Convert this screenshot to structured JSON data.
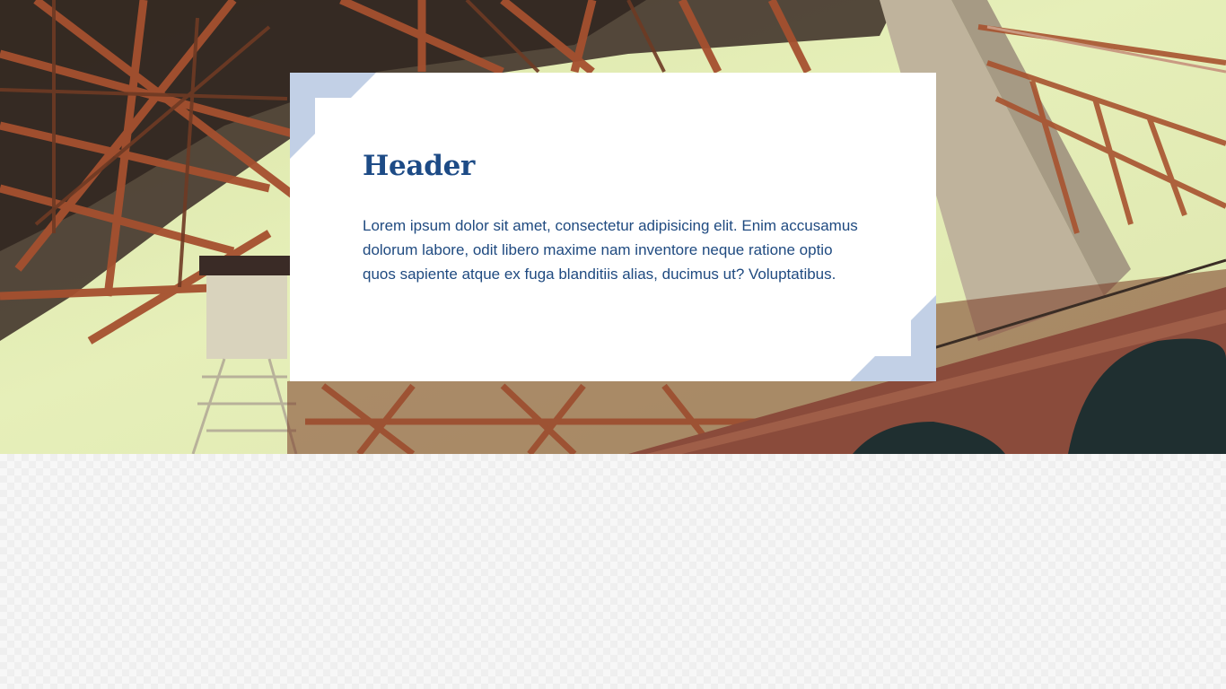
{
  "card": {
    "title": "Header",
    "body": "Lorem ipsum dolor sit amet, consectetur adipisicing elit. Enim accusamus dolorum labore, odit libero maxime nam inventore neque ratione optio quos sapiente atque ex fuga blanditiis alias, ducimus ut? Voluptatibus."
  },
  "colors": {
    "title": "#1d4b86",
    "body": "#1f4a80",
    "corner_accent": "#c2d0e6",
    "card_background": "#ffffff"
  },
  "hero": {
    "image": "steel-bridge-photo"
  }
}
